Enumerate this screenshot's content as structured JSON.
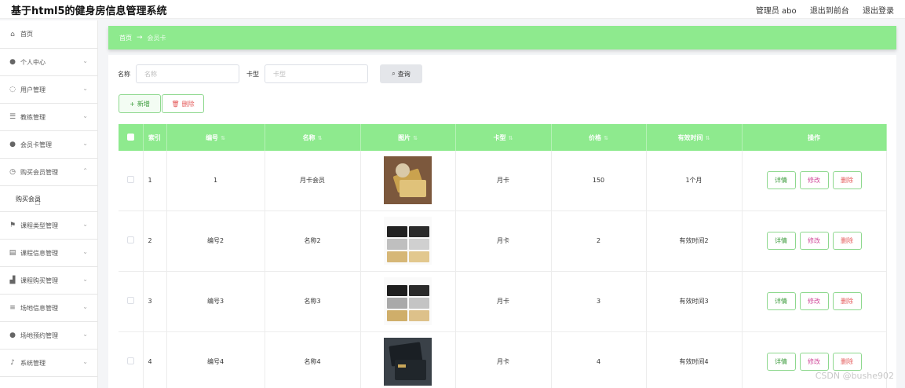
{
  "header": {
    "title": "基于html5的健身房信息管理系统",
    "admin": "管理员 abo",
    "to_front": "退出到前台",
    "logout": "退出登录"
  },
  "sidebar": {
    "items": [
      {
        "label": "首页",
        "icon": "home-icon"
      },
      {
        "label": "个人中心",
        "icon": "user-icon"
      },
      {
        "label": "用户管理",
        "icon": "help-circle-icon"
      },
      {
        "label": "教练管理",
        "icon": "sliders-icon"
      },
      {
        "label": "会员卡管理",
        "icon": "user-icon"
      },
      {
        "label": "购买会员管理",
        "icon": "clock-icon"
      },
      {
        "label": "购买会员",
        "icon": ""
      },
      {
        "label": "课程类型管理",
        "icon": "flag-icon"
      },
      {
        "label": "课程信息管理",
        "icon": "list-icon"
      },
      {
        "label": "课程购买管理",
        "icon": "chart-icon"
      },
      {
        "label": "场地信息管理",
        "icon": "menu-icon"
      },
      {
        "label": "场地预约管理",
        "icon": "user-icon"
      },
      {
        "label": "系统管理",
        "icon": "mic-icon"
      }
    ]
  },
  "breadcrumb": {
    "home": "首页",
    "current": "会员卡"
  },
  "search": {
    "name_label": "名称",
    "name_placeholder": "名称",
    "type_label": "卡型",
    "type_placeholder": "卡型",
    "button": "查询"
  },
  "actions": {
    "add": "新增",
    "delete": "删除"
  },
  "table": {
    "columns": [
      "索引",
      "编号",
      "名称",
      "图片",
      "卡型",
      "价格",
      "有效时间",
      "操作"
    ],
    "rows": [
      {
        "index": "1",
        "code": "1",
        "name": "月卡会员",
        "type": "月卡",
        "price": "150",
        "valid": "1个月"
      },
      {
        "index": "2",
        "code": "编号2",
        "name": "名称2",
        "type": "月卡",
        "price": "2",
        "valid": "有效时间2"
      },
      {
        "index": "3",
        "code": "编号3",
        "name": "名称3",
        "type": "月卡",
        "price": "3",
        "valid": "有效时间3"
      },
      {
        "index": "4",
        "code": "编号4",
        "name": "名称4",
        "type": "月卡",
        "price": "4",
        "valid": "有效时间4"
      }
    ],
    "op_labels": {
      "detail": "详情",
      "edit": "修改",
      "remove": "删除"
    }
  },
  "watermark": "CSDN @bushe902",
  "colors": {
    "accent": "#8eea8e",
    "danger": "#e45b5b",
    "edit": "#d04a9a"
  }
}
